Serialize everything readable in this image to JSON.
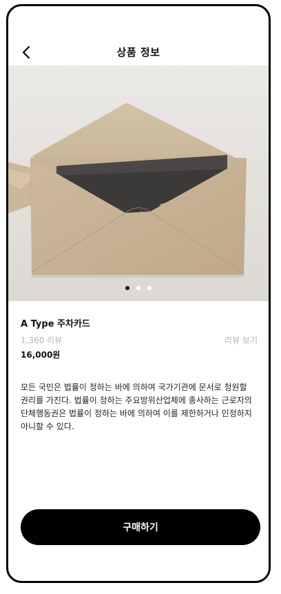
{
  "header": {
    "title": "상품 정보",
    "back_icon": "chevron-left-icon"
  },
  "gallery": {
    "image_subject": "beige envelope with dark card",
    "dot_count": 3,
    "active_index": 0
  },
  "product": {
    "name": "A Type 주차카드",
    "review_count": "1,360 리뷰",
    "review_link": "리뷰 보기",
    "price": "16,000원",
    "description": "모든 국민은 법률이 정하는 바에 의하여 국가기관에 문서로 청원할 권리를 가진다. 법률이 정하는 주요방위산업체에 종사하는 근로자의 단체행동권은 법률이 정하는 바에 의하여 이를 제한하거나 인정하지 아니할 수 있다."
  },
  "footer": {
    "buy_label": "구매하기"
  },
  "colors": {
    "primary": "#000000",
    "muted_text": "#b5b5b5",
    "envelope": "#c9b59a"
  }
}
